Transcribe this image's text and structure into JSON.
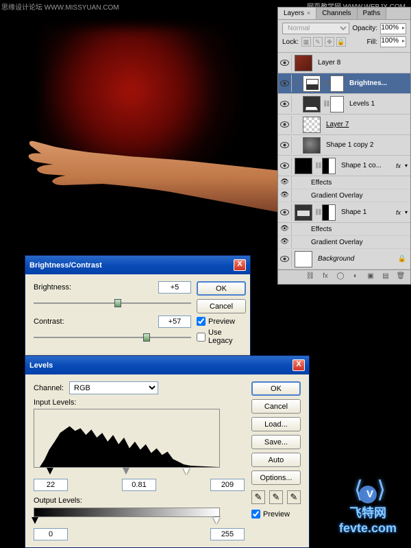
{
  "watermarks": {
    "topleft": "思缘设计论坛 WWW.MISSYUAN.COM",
    "topright": "网页教学网\nWWW.WEBJX.COM",
    "logo_text": "飞特网",
    "logo_url": "fevte.com"
  },
  "bc_dialog": {
    "title": "Brightness/Contrast",
    "brightness_label": "Brightness:",
    "brightness_value": "+5",
    "contrast_label": "Contrast:",
    "contrast_value": "+57",
    "ok": "OK",
    "cancel": "Cancel",
    "preview": "Preview",
    "use_legacy": "Use Legacy",
    "close_x": "X"
  },
  "lv_dialog": {
    "title": "Levels",
    "channel_label": "Channel:",
    "channel_value": "RGB",
    "input_levels_label": "Input Levels:",
    "input_black": "22",
    "input_gamma": "0.81",
    "input_white": "209",
    "output_levels_label": "Output Levels:",
    "output_black": "0",
    "output_white": "255",
    "ok": "OK",
    "cancel": "Cancel",
    "load": "Load...",
    "save": "Save...",
    "auto": "Auto",
    "options": "Options...",
    "preview": "Preview",
    "close_x": "X"
  },
  "layers_panel": {
    "tabs": {
      "layers": "Layers",
      "channels": "Channels",
      "paths": "Paths"
    },
    "blend_mode": "Normal",
    "opacity_label": "Opacity:",
    "opacity_value": "100%",
    "lock_label": "Lock:",
    "fill_label": "Fill:",
    "fill_value": "100%",
    "effects_label": "Effects",
    "gradient_overlay_label": "Gradient Overlay",
    "layers": [
      {
        "name": "Layer 8"
      },
      {
        "name": "Brightnes..."
      },
      {
        "name": "Levels 1"
      },
      {
        "name": "Layer 7"
      },
      {
        "name": "Shape 1 copy 2"
      },
      {
        "name": "Shape 1 co..."
      },
      {
        "name": "Shape 1"
      },
      {
        "name": "Background"
      }
    ],
    "fx_badge": "fx"
  }
}
